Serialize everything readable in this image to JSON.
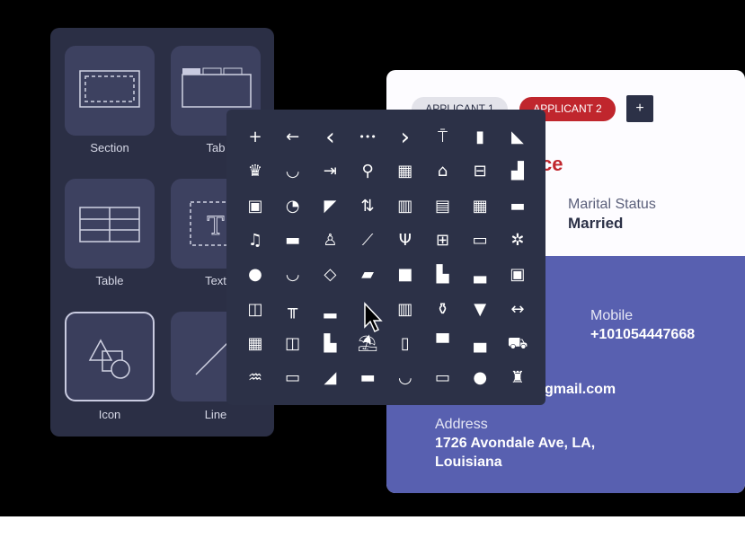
{
  "palette": {
    "tiles": [
      {
        "label": "Section",
        "icon": "section-icon"
      },
      {
        "label": "Tab",
        "icon": "tab-icon"
      },
      {
        "label": "Table",
        "icon": "table-icon"
      },
      {
        "label": "Text",
        "icon": "text-icon"
      },
      {
        "label": "Icon",
        "icon": "shapes-icon",
        "selected": true
      },
      {
        "label": "Line",
        "icon": "line-icon"
      }
    ]
  },
  "form": {
    "tabs": [
      {
        "label": "APPLICANT 1",
        "active": false
      },
      {
        "label": "APPLICANT 2",
        "active": true
      }
    ],
    "add_tab": "+",
    "title_fragment": "ce",
    "marital_label": "Marital Status",
    "marital_value": "Married",
    "mobile_label": "Mobile",
    "mobile_value": "+101054447668",
    "email_fragment": "gmail.com",
    "address_label": "Address",
    "address_line1": "1726 Avondale Ave, LA,",
    "address_line2": "Louisiana",
    "colors": {
      "accent": "#c0262d",
      "blue": "#5860b0",
      "dark": "#2c3147"
    }
  },
  "icon_picker": {
    "icons": [
      [
        "plus",
        "arrow-left",
        "chevron-left",
        "more",
        "chevron-right",
        "antenna",
        "mouse",
        "satellite-dish"
      ],
      [
        "pin-cushion",
        "hd-smile",
        "exit-door",
        "location-pin",
        "qr-code",
        "router",
        "scan",
        "signal"
      ],
      [
        "sim-card",
        "speed-dial",
        "cctv",
        "sort-arrows",
        "barcode-scan",
        "receipt",
        "calculator",
        "credit-cards"
      ],
      [
        "headset",
        "van",
        "dress",
        "escalator",
        "cocktail",
        "gift",
        "banknote",
        "discount"
      ],
      [
        "piggy-bank",
        "basket",
        "target",
        "wallet",
        "box",
        "mailbox",
        "bathtub",
        "safe"
      ],
      [
        "wardrobe",
        "dining-table",
        "bed",
        "cursor-gap",
        "fence",
        "fire-extinguisher",
        "lamp",
        "dumbbell"
      ],
      [
        "cash-register",
        "cabinet",
        "bar-chart",
        "beach",
        "fridge",
        "double-bed",
        "sofa",
        "car-service"
      ],
      [
        "pool-ladder",
        "tv",
        "toilet",
        "rv",
        "mortar-pestle",
        "bandage",
        "drop",
        "tooth"
      ]
    ]
  }
}
